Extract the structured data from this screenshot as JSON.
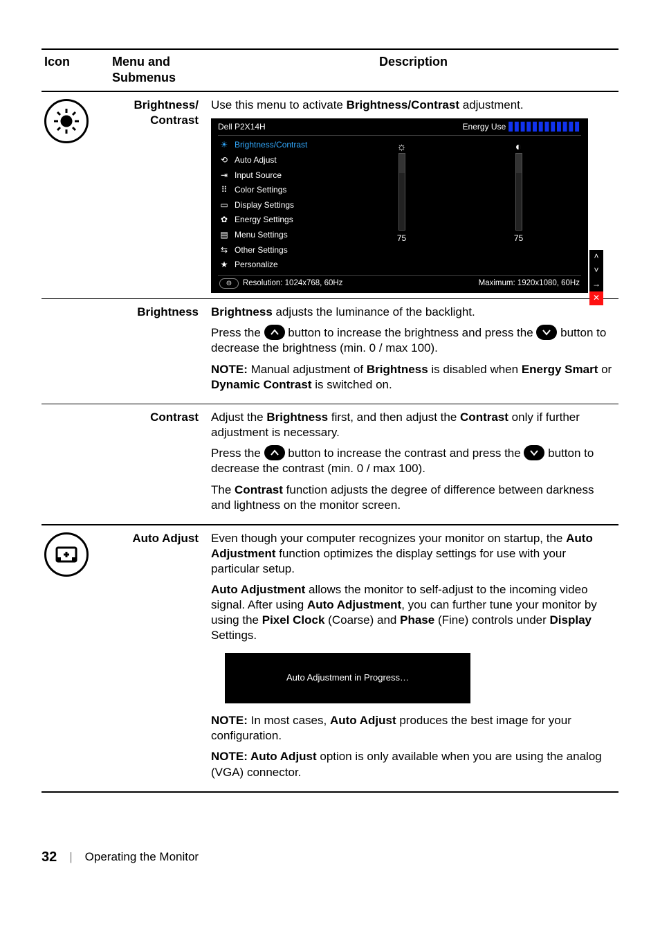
{
  "table": {
    "headers": {
      "icon": "Icon",
      "menu": "Menu and Submenus",
      "desc": "Description"
    }
  },
  "row1": {
    "menu_label": "Brightness/ Contrast",
    "intro_pre": "Use this menu to activate ",
    "intro_bold": "Brightness/Contrast",
    "intro_post": " adjustment."
  },
  "osd": {
    "model": "Dell P2X14H",
    "energy_label": "Energy Use",
    "menu_items": [
      "Brightness/Contrast",
      "Auto Adjust",
      "Input Source",
      "Color Settings",
      "Display Settings",
      "Energy Settings",
      "Menu Settings",
      "Other Settings",
      "Personalize"
    ],
    "brightness_value": "75",
    "contrast_value": "75",
    "resolution_left": "Resolution: 1024x768, 60Hz",
    "resolution_right": "Maximum: 1920x1080, 60Hz"
  },
  "row2": {
    "menu_label": "Brightness",
    "p1_bold": "Brightness",
    "p1_rest": " adjusts the luminance of the backlight.",
    "p2_a": "Press the ",
    "p2_b": " button to increase the brightness and press the ",
    "p2_c": " button to decrease the brightness (min. 0 / max 100).",
    "note_label": "NOTE:",
    "note_a": " Manual adjustment of ",
    "note_bold1": "Brightness",
    "note_b": " is disabled when ",
    "note_bold2": "Energy Smart",
    "note_c": " or ",
    "note_bold3": "Dynamic Contrast",
    "note_d": " is switched on."
  },
  "row3": {
    "menu_label": "Contrast",
    "p1_a": "Adjust the ",
    "p1_bold1": "Brightness",
    "p1_b": " first, and then adjust the ",
    "p1_bold2": "Contrast",
    "p1_c": " only if further adjustment is necessary.",
    "p2_a": "Press the ",
    "p2_b": " button to increase the contrast and press the ",
    "p2_c": " button to decrease the contrast (min. 0 / max 100).",
    "p3_a": "The ",
    "p3_bold": "Contrast",
    "p3_b": " function adjusts the degree of difference between darkness and lightness on the monitor screen."
  },
  "row4": {
    "menu_label": "Auto Adjust",
    "p1_a": "Even though your computer recognizes your monitor on startup, the ",
    "p1_bold": "Auto Adjustment",
    "p1_b": " function optimizes the display settings for use with your particular setup.",
    "p2_bold1": "Auto Adjustment",
    "p2_a": " allows the monitor to self-adjust to the incoming video signal. After using ",
    "p2_bold2": "Auto Adjustment",
    "p2_b": ", you can further tune your monitor by using the ",
    "p2_bold3": "Pixel Clock",
    "p2_c": " (Coarse) and ",
    "p2_bold4": "Phase",
    "p2_d": " (Fine) controls under ",
    "p2_bold5": "Display",
    "p2_e": " Settings.",
    "progress_text": "Auto Adjustment  in Progress…",
    "note1_label": "NOTE:",
    "note1_a": " In most cases, ",
    "note1_bold": "Auto Adjust",
    "note1_b": " produces the best image for your configuration.",
    "note2_label": "NOTE:",
    "note2_bold": " Auto Adjust",
    "note2_a": " option is only available when you are using the analog (VGA) connector."
  },
  "footer": {
    "page_number": "32",
    "section": "Operating the Monitor"
  }
}
